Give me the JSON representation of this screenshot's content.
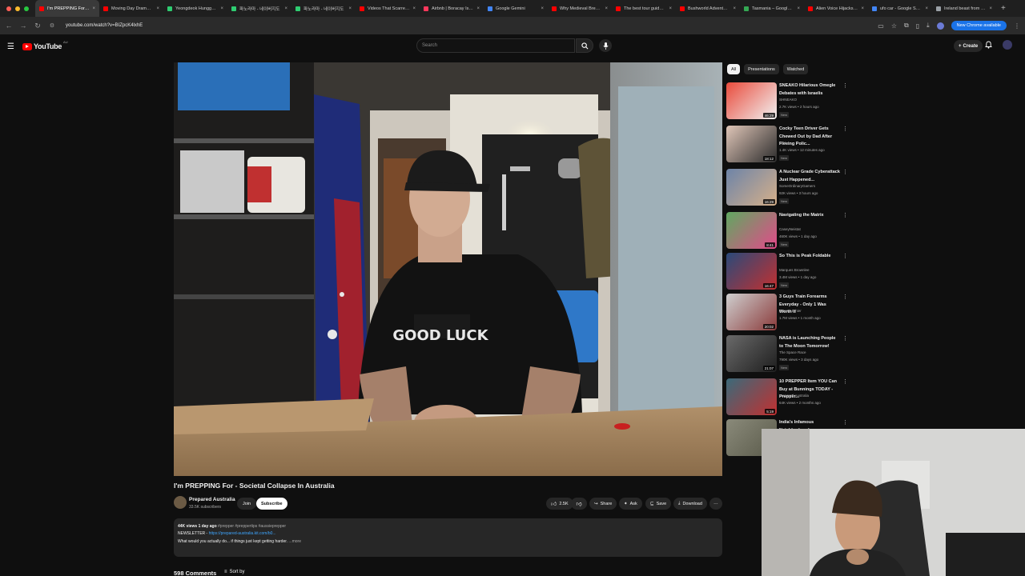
{
  "browser": {
    "tabs": [
      {
        "label": "I'm PREPPING For - S",
        "color": "#ff0000",
        "active": true
      },
      {
        "label": "Moving Day Drama! 🔥",
        "color": "#ff0000"
      },
      {
        "label": "Yeongdeok Hungga - Nai",
        "color": "#2ecc71"
      },
      {
        "label": "파노라마 - 네이버지도",
        "color": "#2ecc71"
      },
      {
        "label": "파노라마 - 네이버지도",
        "color": "#2ecc71"
      },
      {
        "label": "Videos That Scarred Aus",
        "color": "#ff0000"
      },
      {
        "label": "Airbnb | Boracay Island -",
        "color": "#ff385c"
      },
      {
        "label": "Google Gemini",
        "color": "#4285f4"
      },
      {
        "label": "Why Medieval Bread Was",
        "color": "#ff0000"
      },
      {
        "label": "The best tour guide #pla",
        "color": "#ff0000"
      },
      {
        "label": "Bushworld Adventures |",
        "color": "#ff0000"
      },
      {
        "label": "Tasmania – Google sök",
        "color": "#34a853"
      },
      {
        "label": "Alien Voice Hijacks live T",
        "color": "#ff0000"
      },
      {
        "label": "ufo car - Google Search",
        "color": "#4285f4"
      },
      {
        "label": "Ireland beast from the ea",
        "color": "#9aa0a6"
      }
    ],
    "url": "youtube.com/watch?v=BIZpcK4lxhE",
    "chrome_available": "New Chrome available"
  },
  "header": {
    "logo_text": "YouTube",
    "logo_sup": "AU",
    "search_placeholder": "Search",
    "create_label": "Create"
  },
  "video": {
    "title": "I'm PREPPING For - Societal Collapse In Australia",
    "channel": "Prepared Australia",
    "subscribers": "33.5K subscribers",
    "join_label": "Join",
    "subscribe_label": "Subscribe",
    "likes": "2.5K",
    "share_label": "Share",
    "ask_label": "Ask",
    "save_label": "Save",
    "download_label": "Download",
    "shirt_text": "GOOD LUCK"
  },
  "description": {
    "meta": "44K views  1 day ago",
    "tags": "#prepper #preppertips #aussieprepper",
    "newsletter_label": "NEWSLETTER - ",
    "newsletter_link": "https://prepared-australia.kit.com/b0...",
    "body": "What would you actually do... if things just kept getting harder.",
    "more": "...more"
  },
  "comments": {
    "count_label": "598 Comments",
    "sort_label": "Sort by"
  },
  "sidebar": {
    "chips": [
      "All",
      "Presentations",
      "Watched"
    ],
    "recs": [
      {
        "title": "SNEAKO Hilarious Omegle Debates with Israelis",
        "channel": "SHNEAKO",
        "meta": "2.7K views • 2 hours ago",
        "badge": "New",
        "duration": "46:29"
      },
      {
        "title": "Cocky Teen Driver Gets Chewed Out by Dad After Fleeing Polic...",
        "channel": "HGs",
        "meta": "1.4K views • 12 minutes ago",
        "badge": "New",
        "duration": "18:12"
      },
      {
        "title": "A Nuclear Grade Cyberattack Just Happened...",
        "channel": "SomeOrdinaryGamers",
        "meta": "92K views • 3 hours ago",
        "badge": "New",
        "duration": "16:29"
      },
      {
        "title": "Navigating the Matrix",
        "channel": "CaseyNeistat",
        "meta": "460K views • 1 day ago",
        "badge": "New",
        "duration": "8:41"
      },
      {
        "title": "So This is Peak Foldable",
        "channel": "Marques Brownlee",
        "meta": "3.4M views • 1 day ago",
        "badge": "New",
        "duration": "16:47"
      },
      {
        "title": "3 Guys Train Forearms Everyday - Only 1 Was Worth It",
        "channel": "Jeremy Ethier",
        "meta": "1.7M views • 1 month ago",
        "badge": "",
        "duration": "20:02"
      },
      {
        "title": "NASA is Launching People to The Moon Tomorrow!",
        "channel": "The Space Race",
        "meta": "790K views • 3 days ago",
        "badge": "New",
        "duration": "21:07"
      },
      {
        "title": "10 PREPPER Item YOU Can Buy at Bunnings TODAY - Preppin...",
        "channel": "Prepared Australia",
        "meta": "64K views • 2 months ago",
        "badge": "",
        "duration": "5:19"
      },
      {
        "title": "India's Infamous Neighborhood:",
        "channel": "",
        "meta": "",
        "badge": "",
        "duration": ""
      }
    ]
  }
}
